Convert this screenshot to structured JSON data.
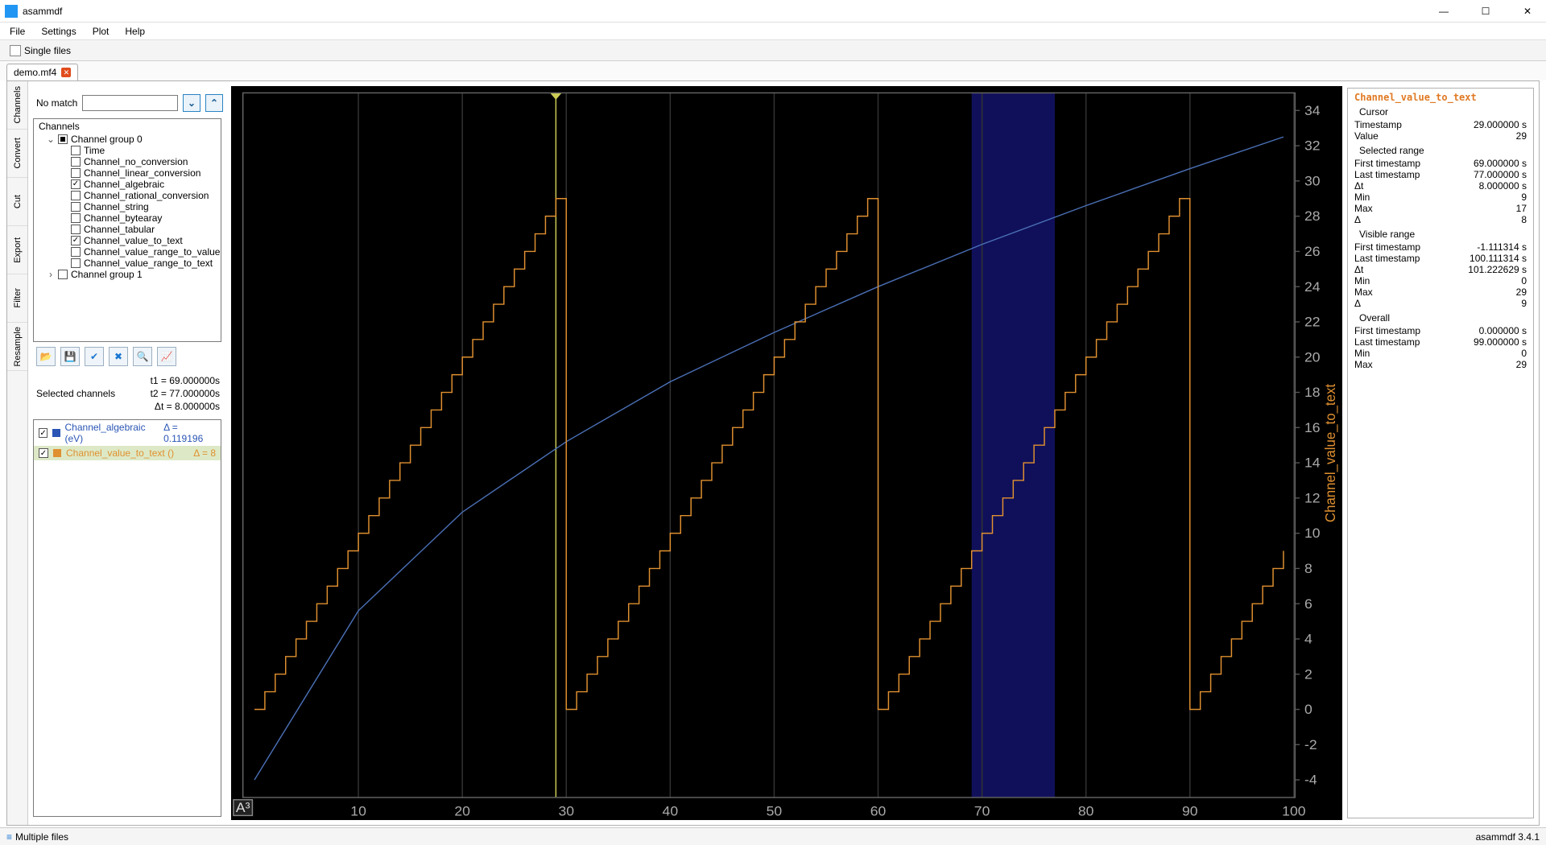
{
  "window": {
    "title": "asammdf"
  },
  "menu": {
    "items": [
      "File",
      "Settings",
      "Plot",
      "Help"
    ]
  },
  "toolbar": {
    "single_files": "Single files"
  },
  "doc_tab": {
    "name": "demo.mf4"
  },
  "side_tabs": [
    "Channels",
    "Convert",
    "Cut",
    "Export",
    "Filter",
    "Resample"
  ],
  "search": {
    "no_match": "No match",
    "value": ""
  },
  "tree": {
    "title": "Channels",
    "group0": {
      "label": "Channel group 0",
      "items": [
        {
          "label": "Time",
          "checked": false
        },
        {
          "label": "Channel_no_conversion",
          "checked": false
        },
        {
          "label": "Channel_linear_conversion",
          "checked": false
        },
        {
          "label": "Channel_algebraic",
          "checked": true
        },
        {
          "label": "Channel_rational_conversion",
          "checked": false
        },
        {
          "label": "Channel_string",
          "checked": false
        },
        {
          "label": "Channel_bytearay",
          "checked": false
        },
        {
          "label": "Channel_tabular",
          "checked": false
        },
        {
          "label": "Channel_value_to_text",
          "checked": true
        },
        {
          "label": "Channel_value_range_to_value",
          "checked": false
        },
        {
          "label": "Channel_value_range_to_text",
          "checked": false
        }
      ]
    },
    "group1": {
      "label": "Channel group 1"
    }
  },
  "stats": {
    "selected_channels_label": "Selected channels",
    "t1": "t1 = 69.000000s",
    "t2": "t2 = 77.000000s",
    "dt": "Δt = 8.000000s"
  },
  "selected": [
    {
      "label": "Channel_algebraic (eV)",
      "color": "#2a55b5",
      "delta": "Δ = 0.119196",
      "active": false
    },
    {
      "label": "Channel_value_to_text ()",
      "color": "#e09030",
      "delta": "Δ = 8",
      "active": true
    }
  ],
  "info_panel": {
    "title": "Channel_value_to_text",
    "sections": [
      {
        "title": "Cursor",
        "rows": [
          {
            "k": "Timestamp",
            "v": "29.000000 s"
          },
          {
            "k": "Value",
            "v": "29"
          }
        ]
      },
      {
        "title": "Selected range",
        "rows": [
          {
            "k": "First timestamp",
            "v": "69.000000 s"
          },
          {
            "k": "Last timestamp",
            "v": "77.000000 s"
          },
          {
            "k": "Δt",
            "v": "8.000000 s"
          },
          {
            "k": "Min",
            "v": "9"
          },
          {
            "k": "Max",
            "v": "17"
          },
          {
            "k": "Δ",
            "v": "8"
          }
        ]
      },
      {
        "title": "Visible range",
        "rows": [
          {
            "k": "First timestamp",
            "v": "-1.111314 s"
          },
          {
            "k": "Last timestamp",
            "v": "100.111314 s"
          },
          {
            "k": "Δt",
            "v": "101.222629 s"
          },
          {
            "k": "Min",
            "v": "0"
          },
          {
            "k": "Max",
            "v": "29"
          },
          {
            "k": "Δ",
            "v": "9"
          }
        ]
      },
      {
        "title": "Overall",
        "rows": [
          {
            "k": "First timestamp",
            "v": "0.000000 s"
          },
          {
            "k": "Last timestamp",
            "v": "99.000000 s"
          },
          {
            "k": "Min",
            "v": "0"
          },
          {
            "k": "Max",
            "v": "29"
          }
        ]
      }
    ]
  },
  "statusbar": {
    "left": "Multiple files",
    "right": "asammdf 3.4.1"
  },
  "chart_data": {
    "type": "line",
    "title": "",
    "xlabel": "",
    "ylabel": "Channel_value_to_text",
    "xlim": [
      -1.11,
      100.11
    ],
    "ylim": [
      -5,
      35
    ],
    "x_ticks": [
      10,
      20,
      30,
      40,
      50,
      60,
      70,
      80,
      90,
      100
    ],
    "y_ticks": [
      -4,
      -2,
      0,
      2,
      4,
      6,
      8,
      10,
      12,
      14,
      16,
      18,
      20,
      22,
      24,
      26,
      28,
      30,
      32,
      34
    ],
    "cursor_x": 29,
    "selection": {
      "x0": 69,
      "x1": 77
    },
    "series": [
      {
        "name": "Channel_algebraic",
        "color": "#4a6fb5",
        "style": "smooth",
        "x": [
          0,
          10,
          20,
          30,
          40,
          50,
          60,
          70,
          80,
          90,
          99
        ],
        "y": [
          -4.0,
          5.6,
          11.2,
          15.2,
          18.6,
          21.4,
          24.0,
          26.4,
          28.6,
          30.7,
          32.5
        ]
      },
      {
        "name": "Channel_value_to_text",
        "color": "#e09030",
        "style": "step",
        "x": [
          0,
          1,
          2,
          3,
          4,
          5,
          6,
          7,
          8,
          9,
          10,
          11,
          12,
          13,
          14,
          15,
          16,
          17,
          18,
          19,
          20,
          21,
          22,
          23,
          24,
          25,
          26,
          27,
          28,
          29,
          30,
          31,
          32,
          33,
          34,
          35,
          36,
          37,
          38,
          39,
          40,
          41,
          42,
          43,
          44,
          45,
          46,
          47,
          48,
          49,
          50,
          51,
          52,
          53,
          54,
          55,
          56,
          57,
          58,
          59,
          60,
          61,
          62,
          63,
          64,
          65,
          66,
          67,
          68,
          69,
          70,
          71,
          72,
          73,
          74,
          75,
          76,
          77,
          78,
          79,
          80,
          81,
          82,
          83,
          84,
          85,
          86,
          87,
          88,
          89,
          90,
          91,
          92,
          93,
          94,
          95,
          96,
          97,
          98,
          99
        ],
        "y": [
          0,
          1,
          2,
          3,
          4,
          5,
          6,
          7,
          8,
          9,
          10,
          11,
          12,
          13,
          14,
          15,
          16,
          17,
          18,
          19,
          20,
          21,
          22,
          23,
          24,
          25,
          26,
          27,
          28,
          29,
          0,
          1,
          2,
          3,
          4,
          5,
          6,
          7,
          8,
          9,
          10,
          11,
          12,
          13,
          14,
          15,
          16,
          17,
          18,
          19,
          20,
          21,
          22,
          23,
          24,
          25,
          26,
          27,
          28,
          29,
          0,
          1,
          2,
          3,
          4,
          5,
          6,
          7,
          8,
          9,
          10,
          11,
          12,
          13,
          14,
          15,
          16,
          17,
          18,
          19,
          20,
          21,
          22,
          23,
          24,
          25,
          26,
          27,
          28,
          29,
          0,
          1,
          2,
          3,
          4,
          5,
          6,
          7,
          8,
          9
        ]
      }
    ]
  }
}
